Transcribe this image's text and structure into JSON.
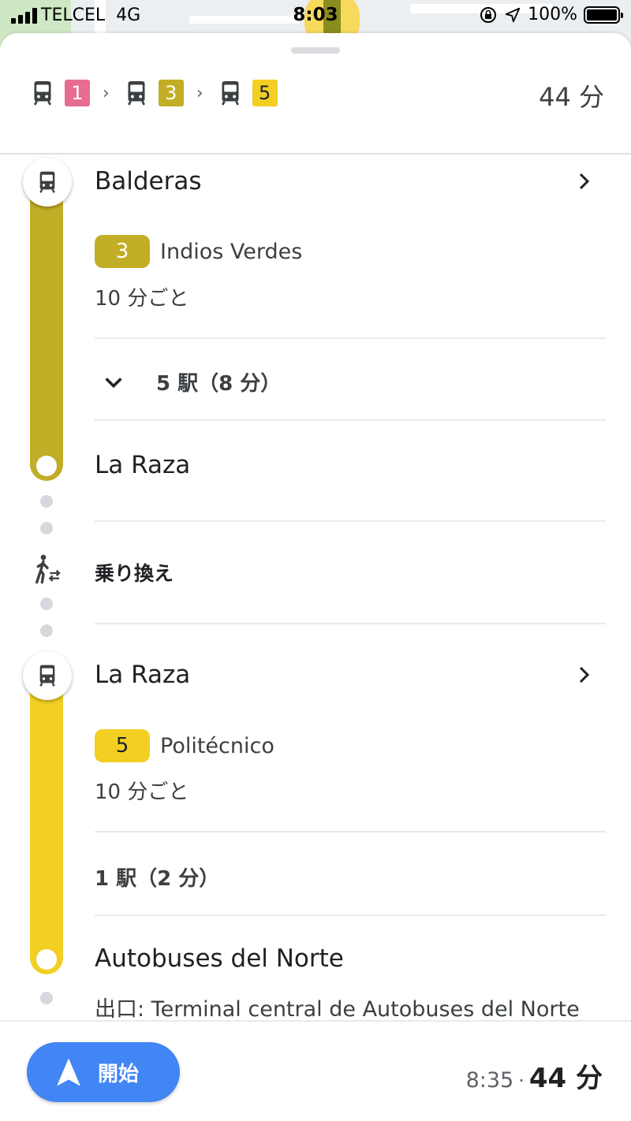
{
  "status_bar": {
    "carrier": "TELCEL",
    "network": "4G",
    "time": "8:03",
    "battery": "100%"
  },
  "summary": {
    "segments": [
      {
        "line": "1",
        "color": "#e86c92",
        "text_color": "#ffffff"
      },
      {
        "line": "3",
        "color": "#c2ad26",
        "text_color": "#ffffff"
      },
      {
        "line": "5",
        "color": "#f1cf23",
        "text_color": "#202124"
      }
    ],
    "total_time": "44 分"
  },
  "legs": [
    {
      "board_stop": "Balderas",
      "line": "3",
      "line_color": "#c2ad26",
      "line_text_color": "#ffffff",
      "headsign": "Indios Verdes",
      "frequency": "10 分ごと",
      "stops": "5 駅（8 分）",
      "alight_stop": "La Raza"
    },
    {
      "board_stop": "La Raza",
      "line": "5",
      "line_color": "#f1cf23",
      "line_text_color": "#202124",
      "headsign": "Politécnico",
      "frequency": "10 分ごと",
      "stops": "1 駅（2 分）",
      "alight_stop": "Autobuses del Norte",
      "exit": "出口: Terminal central de Autobuses del Norte"
    }
  ],
  "transfer_label": "乗り換え",
  "bottom": {
    "start_label": "開始",
    "arrival_time": "8:35",
    "separator": "·",
    "duration": "44 分",
    "accent": "#4285f4"
  }
}
